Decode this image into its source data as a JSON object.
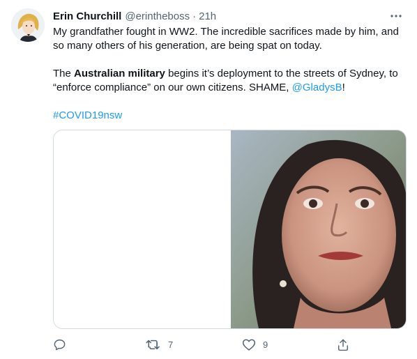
{
  "tweet": {
    "author_name": "Erin Churchill",
    "handle": "@erintheboss",
    "separator": "·",
    "time": "21h",
    "more_icon": "more-horizontal-icon",
    "text": {
      "para1": "My grandfather fought in WW2. The incredible sacrifices made by him, and so many others of his generation, are being spat on today.",
      "para2_a": "The ",
      "para2_bold": "Australian military",
      "para2_b": " begins it’s deployment to the streets of Sydney, to “enforce compliance” on our own citizens. SHAME, ",
      "mention": "@GladysB",
      "para2_c": "!",
      "hashtag": "#COVID19nsw"
    },
    "actions": {
      "reply_icon": "reply-icon",
      "retweet_icon": "retweet-icon",
      "retweet_count": "7",
      "like_icon": "heart-icon",
      "like_count": "9",
      "share_icon": "share-icon"
    },
    "colors": {
      "link": "#1d9bf0",
      "muted": "#536471",
      "text": "#0f1419",
      "border": "#cfd9de"
    }
  }
}
